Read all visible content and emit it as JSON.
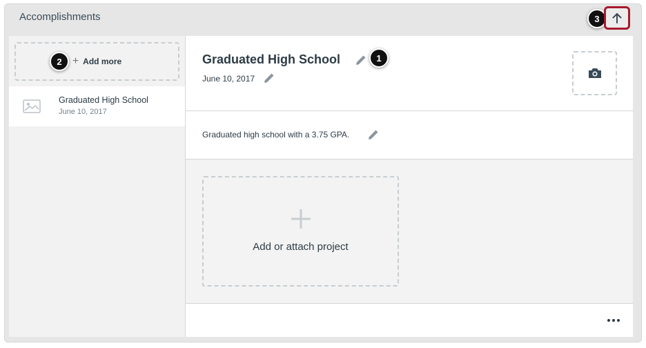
{
  "header": {
    "title": "Accomplishments",
    "up_icon": "arrow-up-icon"
  },
  "callouts": {
    "one": "1",
    "two": "2",
    "three": "3"
  },
  "sidebar": {
    "add_more_label": "Add more",
    "items": [
      {
        "title": "Graduated High School",
        "date": "June 10, 2017",
        "thumb_icon": "image-placeholder-icon"
      }
    ]
  },
  "detail": {
    "title": "Graduated High School",
    "date": "June 10, 2017",
    "description": "Graduated high school with a 3.75 GPA.",
    "camera_icon": "camera-icon",
    "edit_icon": "pencil-icon"
  },
  "projects": {
    "add_label": "Add or attach project"
  },
  "colors": {
    "accent_border": "#a8192e",
    "text": "#2d3b45",
    "muted": "#73818c",
    "panel_bg": "#e6e6e6"
  }
}
